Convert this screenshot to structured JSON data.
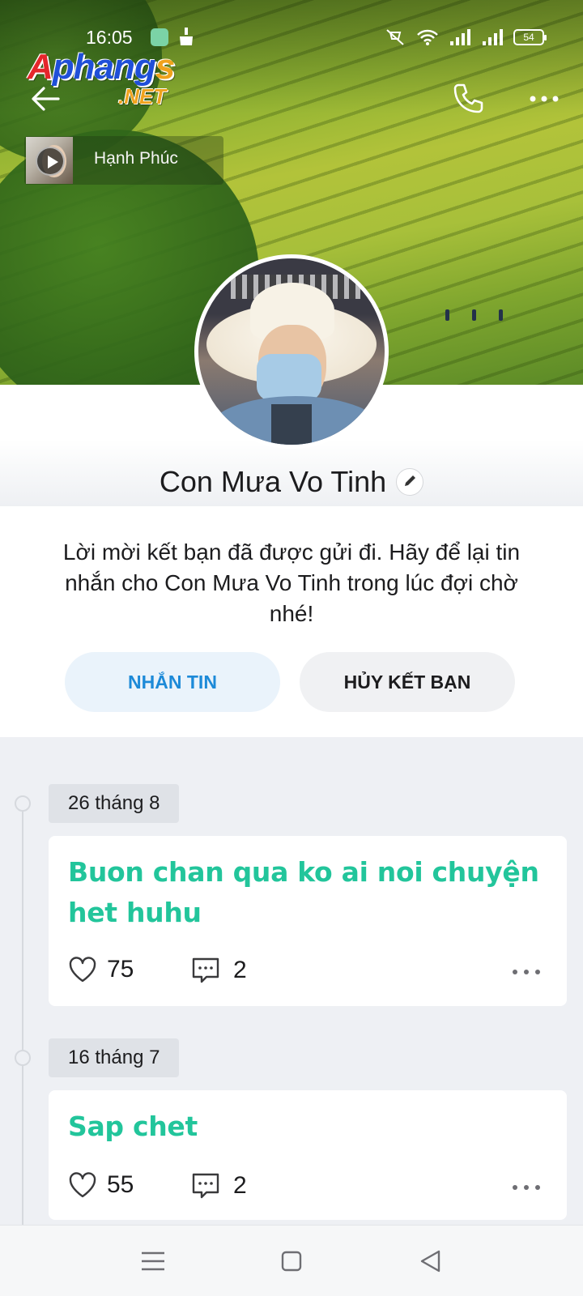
{
  "status_bar": {
    "time": "16:05",
    "battery": "54"
  },
  "watermark": {
    "brand_a": "A",
    "brand_rest": "phang",
    "brand_s": "s",
    "domain": ".NET"
  },
  "music": {
    "title": "Hạnh Phúc"
  },
  "profile": {
    "name": "Con Mưa Vo Tinh",
    "invite_message": "Lời mời kết bạn đã được gửi đi. Hãy để lại tin nhắn cho Con Mưa Vo Tinh trong lúc đợi chờ nhé!",
    "message_button": "NHẮN TIN",
    "unfriend_button": "HỦY KẾT BẠN"
  },
  "posts": [
    {
      "date": "26 tháng 8",
      "text_line1": "Buon chan qua ko ai noi chuyện",
      "text_line2": "het huhu",
      "likes": "75",
      "comments": "2"
    },
    {
      "date": "16 tháng 7",
      "text_line1": "Sap chet",
      "likes": "55",
      "comments": "2"
    }
  ],
  "colors": {
    "accent_blue": "#1d8ad8",
    "post_text_green": "#22c59b"
  },
  "icons": [
    "back-arrow-icon",
    "phone-icon",
    "more-icon",
    "play-icon",
    "edit-pencil-icon",
    "heart-icon",
    "comment-icon",
    "menu-icon",
    "home-icon",
    "back-triangle-icon"
  ]
}
